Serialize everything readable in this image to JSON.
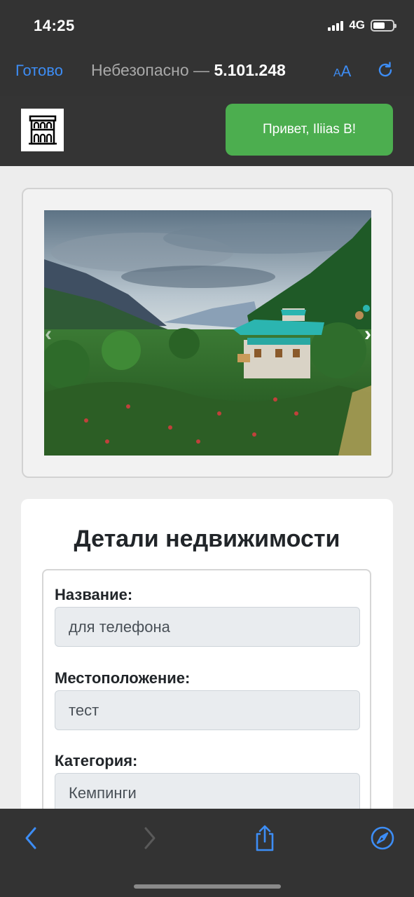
{
  "status_bar": {
    "time": "14:25",
    "network": "4G",
    "battery_level": 0.6
  },
  "browser": {
    "done_label": "Готово",
    "security_label": "Небезопасно —",
    "host": "5.101.248",
    "text_size_label_small": "A",
    "text_size_label_large": "A",
    "accent_color": "#3d8df5"
  },
  "site_header": {
    "logo_icon": "building-icon",
    "greeting_button": "Привет, Iliias B!",
    "greeting_color": "#4cae4f"
  },
  "carousel": {
    "image_alt": "house-in-mountain-valley-photo",
    "prev_icon": "chevron-left-icon",
    "next_icon": "chevron-right-icon"
  },
  "details": {
    "title": "Детали недвижимости",
    "fields": [
      {
        "label": "Название:",
        "value": "для телефона"
      },
      {
        "label": "Местоположение:",
        "value": "тест"
      },
      {
        "label": "Категория:",
        "value": "Кемпинги"
      }
    ]
  },
  "toolbar": {
    "back_icon": "chevron-left-icon",
    "forward_icon": "chevron-right-icon",
    "share_icon": "share-icon",
    "compass_icon": "compass-icon"
  }
}
